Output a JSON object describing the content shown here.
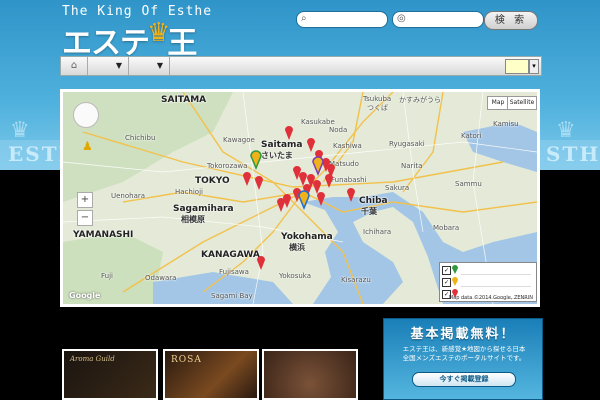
{
  "header": {
    "logo_tagline": "The King Of Esthe",
    "logo_left": "エステ",
    "logo_right": "王",
    "search_button": "検 索",
    "band_left": "ESTH",
    "band_right": "STHE"
  },
  "navbar": {
    "home_icon": "home-icon"
  },
  "map": {
    "type_buttons": [
      "Map",
      "Satellite"
    ],
    "places": [
      {
        "id": "saitama-pref",
        "label": "SAITAMA"
      },
      {
        "id": "saitama-city",
        "label": "Saitama"
      },
      {
        "id": "saitama-jp",
        "label": "さいたま"
      },
      {
        "id": "tokyo",
        "label": "TOKYO"
      },
      {
        "id": "sagamihara",
        "label": "Sagamihara"
      },
      {
        "id": "sagamihara-jp",
        "label": "相模原"
      },
      {
        "id": "yokohama",
        "label": "Yokohama"
      },
      {
        "id": "yokohama-jp",
        "label": "横浜"
      },
      {
        "id": "chiba",
        "label": "Chiba"
      },
      {
        "id": "chiba-jp",
        "label": "千葉"
      },
      {
        "id": "kanagawa",
        "label": "KANAGAWA"
      },
      {
        "id": "yamanashi",
        "label": "YAMANASHI"
      },
      {
        "id": "kawagoe",
        "label": "Kawagoe"
      },
      {
        "id": "tokorozawa",
        "label": "Tokorozawa"
      },
      {
        "id": "funabashi",
        "label": "Funabashi"
      },
      {
        "id": "kasukabe",
        "label": "Kasukabe"
      },
      {
        "id": "noda",
        "label": "Noda"
      },
      {
        "id": "kashiwa",
        "label": "Kashiwa"
      },
      {
        "id": "tsukuba",
        "label": "Tsukuba"
      },
      {
        "id": "tsukuba-jp",
        "label": "つくば"
      },
      {
        "id": "kasumigaura",
        "label": "かすみがうら"
      },
      {
        "id": "ryugasaki",
        "label": "Ryugasaki"
      },
      {
        "id": "narita",
        "label": "Narita"
      },
      {
        "id": "sakura",
        "label": "Sakura"
      },
      {
        "id": "ichihara",
        "label": "Ichihara"
      },
      {
        "id": "kisarazu",
        "label": "Kisarazu"
      },
      {
        "id": "yokosuka",
        "label": "Yokosuka"
      },
      {
        "id": "fujisawa",
        "label": "Fujisawa"
      },
      {
        "id": "chichibu",
        "label": "Chichibu"
      },
      {
        "id": "fuji",
        "label": "Fuji"
      },
      {
        "id": "odawara",
        "label": "Odawara"
      },
      {
        "id": "sagami-bay",
        "label": "Sagami Bay"
      },
      {
        "id": "sammu",
        "label": "Sammu"
      },
      {
        "id": "mobara",
        "label": "Mobara"
      },
      {
        "id": "katori",
        "label": "Katori"
      },
      {
        "id": "kamisu",
        "label": "Kamisu"
      },
      {
        "id": "uenohara",
        "label": "Uenohara"
      },
      {
        "id": "hachioji",
        "label": "Hachioji"
      },
      {
        "id": "matsudo",
        "label": "Matsudo"
      }
    ],
    "google_label": "Google",
    "map_data": "Map data ©2014 Google, ZENRIN"
  },
  "banner": {
    "title": "基本掲載無料！",
    "text_line1": "エステ王は、新感覚★地図から探せる日本",
    "text_line2": "全国メンズエステのポータルサイトです。",
    "button": "今すぐ掲載登録"
  },
  "thumbs": [
    {
      "label": "Aroma Guild"
    },
    {
      "label": "ROSA"
    },
    {
      "label": ""
    }
  ],
  "colors": {
    "header_blue": "#2f94c8",
    "accent_gold": "#f0b21a",
    "pin_red": "#e0303a"
  }
}
